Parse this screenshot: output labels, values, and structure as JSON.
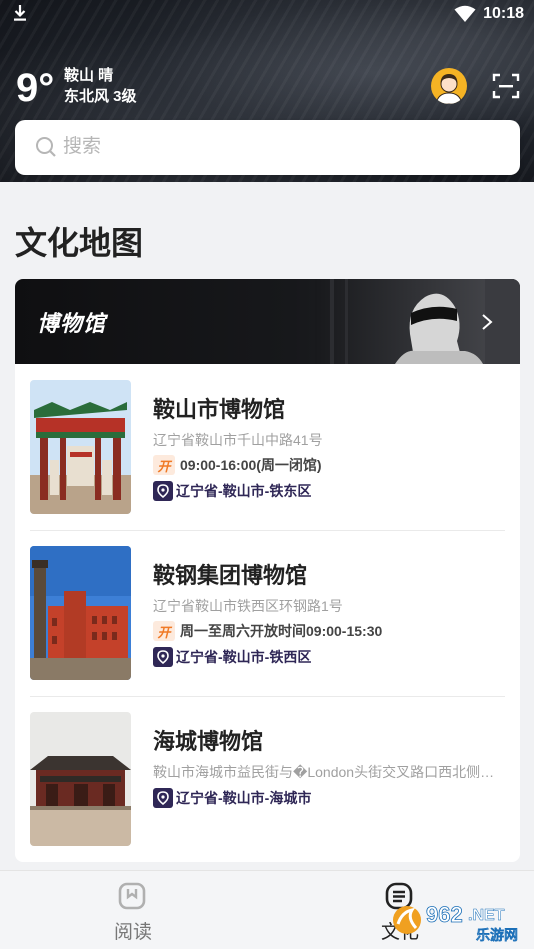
{
  "status_bar": {
    "time": "10:18"
  },
  "weather": {
    "temperature": "9°",
    "city_condition": "鞍山 晴",
    "wind": "东北风 3级"
  },
  "search": {
    "placeholder": "搜索"
  },
  "section": {
    "title": "文化地图"
  },
  "banner": {
    "title": "博物馆"
  },
  "museums": [
    {
      "name": "鞍山市博物馆",
      "address": "辽宁省鞍山市千山中路41号",
      "open_badge": "开",
      "hours": "09:00-16:00(周一闭馆)",
      "region": "辽宁省-鞍山市-铁东区"
    },
    {
      "name": "鞍钢集团博物馆",
      "address": "辽宁省鞍山市铁西区环钢路1号",
      "open_badge": "开",
      "hours": "周一至周六开放时间09:00-15:30",
      "region": "辽宁省-鞍山市-铁西区"
    },
    {
      "name": "海城博物馆",
      "address": "鞍山市海城市益民街与�London头街交叉路口西北侧(中基·...",
      "region": "辽宁省-鞍山市-海城市"
    }
  ],
  "tabbar": {
    "tabs": [
      {
        "label": "阅读"
      },
      {
        "label": "文化"
      }
    ]
  },
  "watermark": {
    "text_top": "962.NET",
    "text_bottom": "乐游网"
  },
  "colors": {
    "accent": "#2f2756",
    "open_badge": "#f07a26",
    "avatar_bg": "#f5b324"
  },
  "icons": {
    "download": "download-icon",
    "wifi": "wifi-icon",
    "scan": "scan-icon",
    "search": "search-icon",
    "chevron": "chevron-right-icon",
    "pin": "location-pin-icon"
  }
}
